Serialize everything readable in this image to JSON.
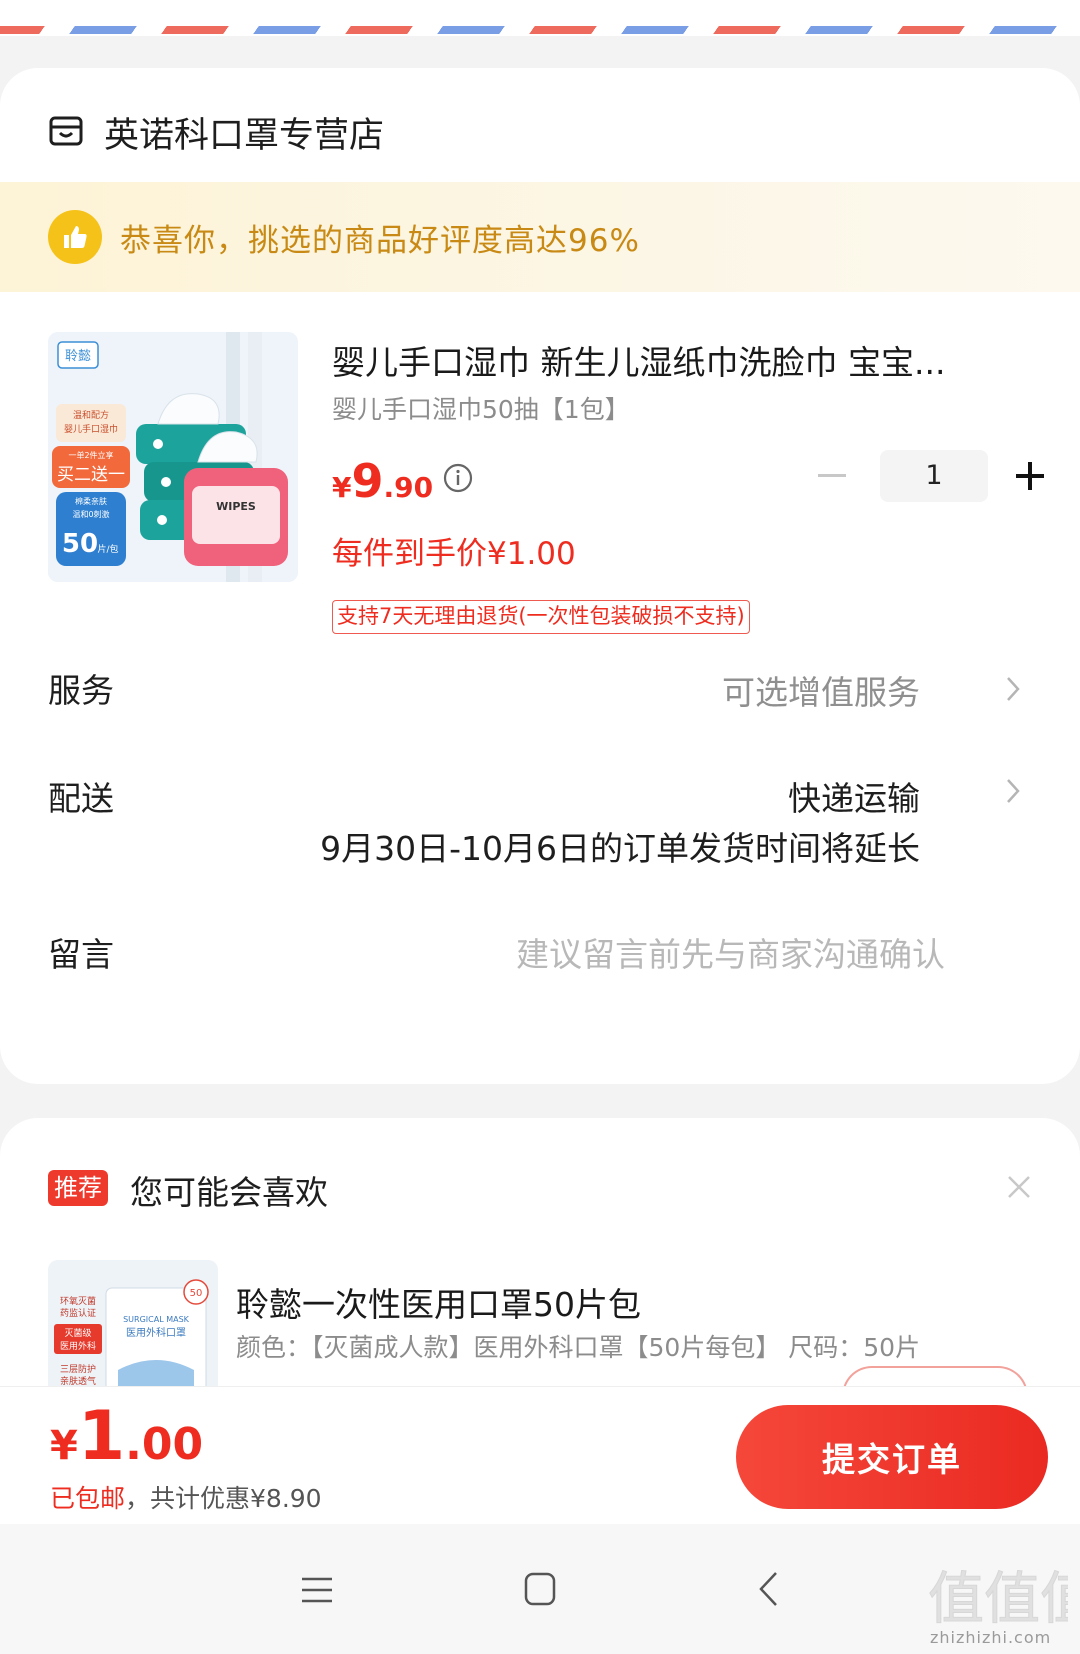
{
  "store": {
    "name": "英诺科口罩专营店"
  },
  "banner": {
    "text": "恭喜你，挑选的商品好评度高达96%"
  },
  "product": {
    "title": "婴儿手口湿巾 新生儿湿纸巾洗脸巾 宝宝...",
    "sku": "婴儿手口湿巾50抽【1包】",
    "price_currency": "¥",
    "price_int": "9",
    "price_dec": ".90",
    "quantity": "1",
    "unit_price": "每件到手价¥1.00",
    "return_policy": "支持7天无理由退货(一次性包装破损不支持)",
    "image": {
      "brand": "聆懿",
      "tag1": "温和配方",
      "tag1b": "婴儿手口湿巾",
      "promo_small": "一单2件立享",
      "promo": "买二送一",
      "tag2": "棉柔亲肤",
      "tag2b": "温和0刺激",
      "count": "50",
      "count_unit": "片/包",
      "pack_label": "WIPES"
    }
  },
  "service": {
    "label": "服务",
    "value": "可选增值服务"
  },
  "delivery": {
    "label": "配送",
    "method": "快递运输",
    "notice": "9月30日-10月6日的订单发货时间将延长"
  },
  "message": {
    "label": "留言",
    "placeholder": "建议留言前先与商家沟通确认"
  },
  "recommend": {
    "badge": "推荐",
    "title": "您可能会喜欢",
    "item": {
      "name": "聆懿一次性医用口罩50片包",
      "spec": "颜色：【灭菌成人款】医用外科口罩【50片每包】   尺码：50片",
      "image": {
        "t1": "环氧灭菌",
        "t1b": "药监认证",
        "t2": "灭菌级",
        "t2b": "医用外科",
        "t3": "三层防护",
        "t3b": "亲肤透气",
        "box_en": "SURGICAL MASK",
        "box_cn": "医用外科口罩",
        "seal": "50"
      }
    }
  },
  "footer": {
    "currency": "¥",
    "total_int": "1",
    "total_dec": ".00",
    "note_red": "已包邮",
    "note_grey": "，共计优惠¥8.90",
    "submit_label": "提交订单"
  },
  "watermark": {
    "text": "zhizhizhi.com",
    "logo": "值值值"
  },
  "colors": {
    "accent": "#ee2c1f",
    "banner_text": "#c88a14",
    "badge_yellow": "#f5c219"
  }
}
